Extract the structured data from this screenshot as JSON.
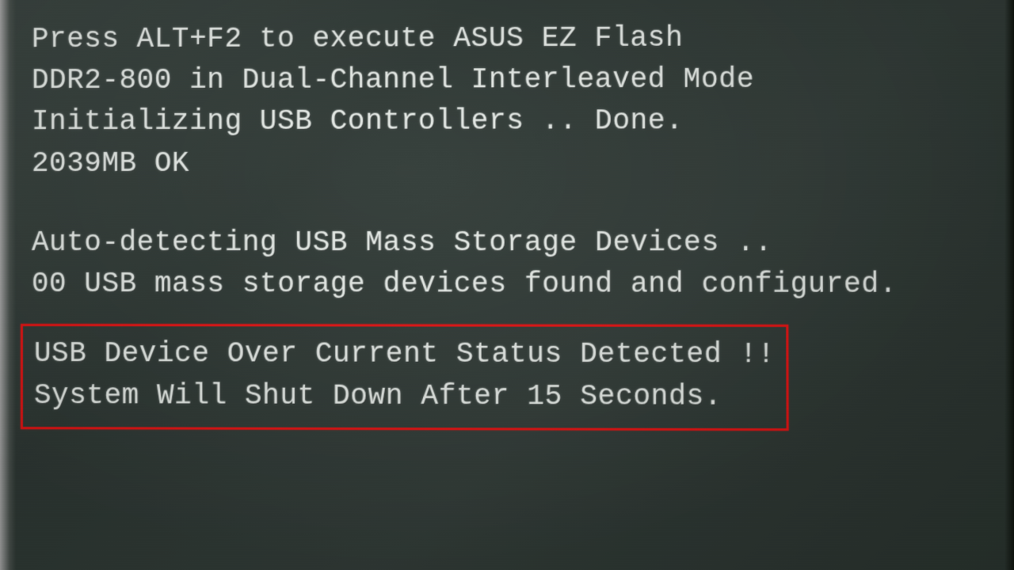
{
  "boot": {
    "line1": "Press ALT+F2 to execute ASUS EZ Flash",
    "line2": "DDR2-800 in Dual-Channel Interleaved Mode",
    "line3": "Initializing USB Controllers .. Done.",
    "line4": "2039MB OK",
    "line5": "Auto-detecting USB Mass Storage Devices ..",
    "line6": "00 USB mass storage devices found and configured.",
    "error_line1": "USB Device Over Current Status Detected !!",
    "error_line2": "System Will Shut Down After 15 Seconds."
  }
}
